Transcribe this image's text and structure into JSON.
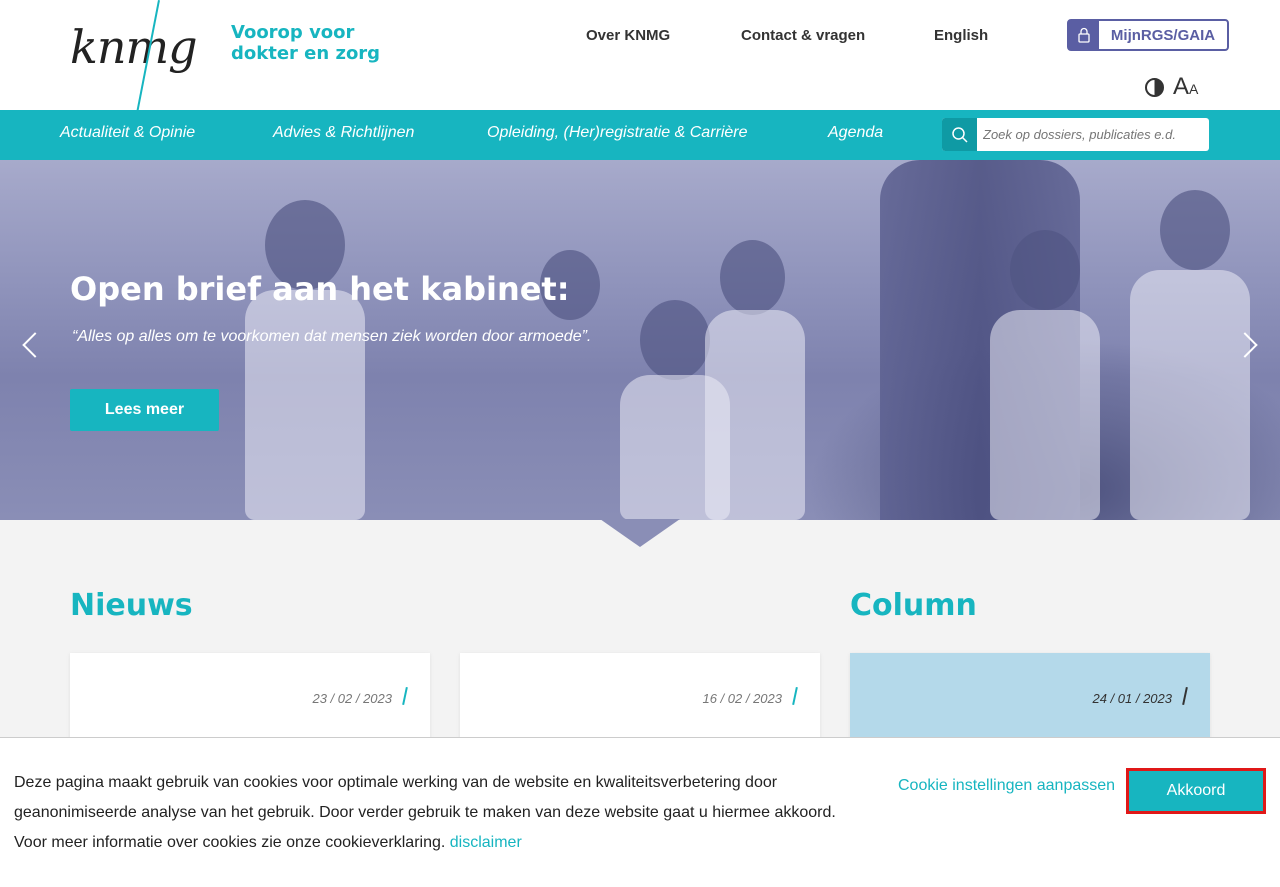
{
  "header": {
    "logo_text": "knmg",
    "tagline_line1": "Voorop voor",
    "tagline_line2": "dokter en zorg",
    "links": [
      "Over KNMG",
      "Contact & vragen",
      "English"
    ],
    "login_label": "MijnRGS/GAIA",
    "font_size_large": "A",
    "font_size_small": "A"
  },
  "nav": {
    "items": [
      "Actualiteit & Opinie",
      "Advies & Richtlijnen",
      "Opleiding, (Her)registratie & Carrière",
      "Agenda"
    ],
    "search_placeholder": "Zoek op dossiers, publicaties e.d."
  },
  "hero": {
    "title": "Open brief aan het kabinet:",
    "subtitle": "“Alles op alles om te voorkomen dat mensen ziek worden door armoede”.",
    "button_label": "Lees meer"
  },
  "sections": {
    "news_title": "Nieuws",
    "column_title": "Column"
  },
  "cards": [
    {
      "date": "23 / 02 / 2023"
    },
    {
      "date": "16 / 02 / 2023"
    },
    {
      "date": "24 / 01 / 2023"
    }
  ],
  "cookie": {
    "text": "Deze pagina maakt gebruik van cookies voor optimale werking van de website en kwaliteitsverbetering door geanonimiseerde analyse van het gebruik. Door verder gebruik te maken van deze website gaat u hiermee akkoord. Voor meer informatie over cookies zie onze cookieverklaring.",
    "link_label": "disclaimer",
    "settings_label": "Cookie instellingen aanpassen",
    "accept_label": "Akkoord"
  },
  "colors": {
    "brand_teal": "#17b5c0",
    "login_purple": "#5a5ea3",
    "column_card_blue": "#b4d9ea",
    "highlight_red": "#e01818"
  }
}
